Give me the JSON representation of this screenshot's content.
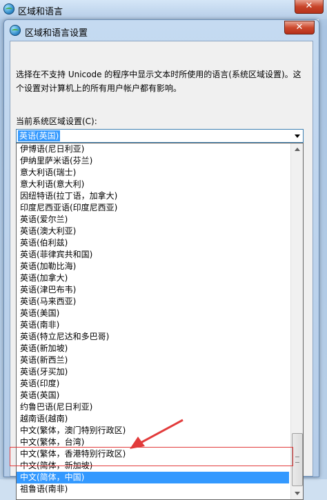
{
  "outer_window": {
    "title": "区域和语言",
    "close_label": "✕"
  },
  "dialog": {
    "title": "区域和语言设置",
    "close_label": "✕",
    "description": "选择在不支持 Unicode 的程序中显示文本时所使用的语言(系统区域设置)。这个设置对计算机上的所有用户帐户都有影响。",
    "locale_label": "当前系统区域设置(C):",
    "current_value": "英语(英国)"
  },
  "locale_list": {
    "items": [
      "伊博语(尼日利亚)",
      "伊纳里萨米语(芬兰)",
      "意大利语(瑞士)",
      "意大利语(意大利)",
      "因纽特语(拉丁语，加拿大)",
      "印度尼西亚语(印度尼西亚)",
      "英语(爱尔兰)",
      "英语(澳大利亚)",
      "英语(伯利兹)",
      "英语(菲律宾共和国)",
      "英语(加勒比海)",
      "英语(加拿大)",
      "英语(津巴布韦)",
      "英语(马来西亚)",
      "英语(美国)",
      "英语(南非)",
      "英语(特立尼达和多巴哥)",
      "英语(新加坡)",
      "英语(新西兰)",
      "英语(牙买加)",
      "英语(印度)",
      "英语(英国)",
      "约鲁巴语(尼日利亚)",
      "越南语(越南)",
      "中文(繁体，澳门特别行政区)",
      "中文(繁体，台湾)",
      "中文(繁体，香港特别行政区)",
      "中文(简体，新加坡)",
      "中文(简体，中国)",
      "祖鲁语(南非)"
    ],
    "selected_index": 28
  },
  "colors": {
    "selection": "#3399ff",
    "annotation": "#e23b3b"
  }
}
